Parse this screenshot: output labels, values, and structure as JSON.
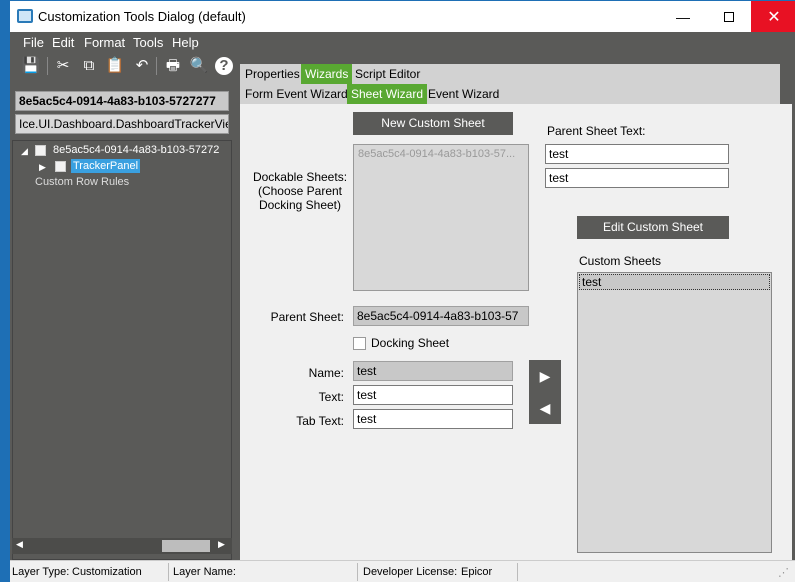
{
  "window": {
    "title": "Customization Tools Dialog (default)",
    "controls": {
      "minimize": "—",
      "maximize": "",
      "close": "✕"
    }
  },
  "menu": [
    "File",
    "Edit",
    "Format",
    "Tools",
    "Help"
  ],
  "toolbar": {
    "icons": [
      "save-icon",
      "cut-icon",
      "copy-icon",
      "paste-icon",
      "undo-icon",
      "print-icon",
      "print-preview-icon",
      "help-icon"
    ],
    "glyphs": {
      "save": "💾",
      "cut": "✂",
      "copy": "⧉",
      "paste": "📋",
      "undo": "↶",
      "print": "🖶",
      "preview": "🔍",
      "help": "?"
    }
  },
  "left": {
    "id_field": "8e5ac5c4-0914-4a83-b103-5727277",
    "path_field": "Ice.UI.Dashboard.DashboardTrackerVie",
    "tree": {
      "root": "8e5ac5c4-0914-4a83-b103-57272",
      "child": "TrackerPanel",
      "extra": "Custom Row Rules"
    }
  },
  "tabs": {
    "row1": [
      {
        "label": "Properties",
        "active": false
      },
      {
        "label": "Wizards",
        "active": true
      },
      {
        "label": "Script Editor",
        "active": false
      }
    ],
    "row2": [
      {
        "label": "Form Event Wizard",
        "active": false
      },
      {
        "label": "Sheet Wizard",
        "active": true
      },
      {
        "label": "Event Wizard",
        "active": false
      }
    ]
  },
  "sheet_wizard": {
    "new_custom_sheet": "New Custom Sheet",
    "parent_sheet_text_label": "Parent Sheet Text:",
    "parent_sheet_text_1": "test",
    "parent_sheet_text_2": "test",
    "dockable_label_1": "Dockable Sheets:",
    "dockable_label_2": "(Choose Parent",
    "dockable_label_3": "Docking Sheet)",
    "dockable_item": "8e5ac5c4-0914-4a83-b103-57...",
    "edit_custom_sheet": "Edit Custom Sheet",
    "custom_sheets_label": "Custom Sheets",
    "custom_sheets": [
      "test"
    ],
    "parent_sheet_label": "Parent Sheet:",
    "parent_sheet_value": "8e5ac5c4-0914-4a83-b103-57",
    "docking_sheet_label": "Docking Sheet",
    "docking_sheet_checked": false,
    "name_label": "Name:",
    "name_value": "test",
    "text_label": "Text:",
    "text_value": "test",
    "tab_text_label": "Tab Text:",
    "tab_text_value": "test",
    "move_right": "▶",
    "move_left": "◀"
  },
  "status": {
    "layer_type_label": "Layer Type:",
    "layer_type_value": "Customization",
    "layer_name_label": "Layer Name:",
    "layer_name_value": "",
    "license_label": "Developer License:",
    "license_value": "Epicor"
  },
  "colors": {
    "accent_green": "#59a832",
    "selection_blue": "#3aa0e0",
    "close_red": "#e81123",
    "panel_gray": "#5a5a58"
  }
}
